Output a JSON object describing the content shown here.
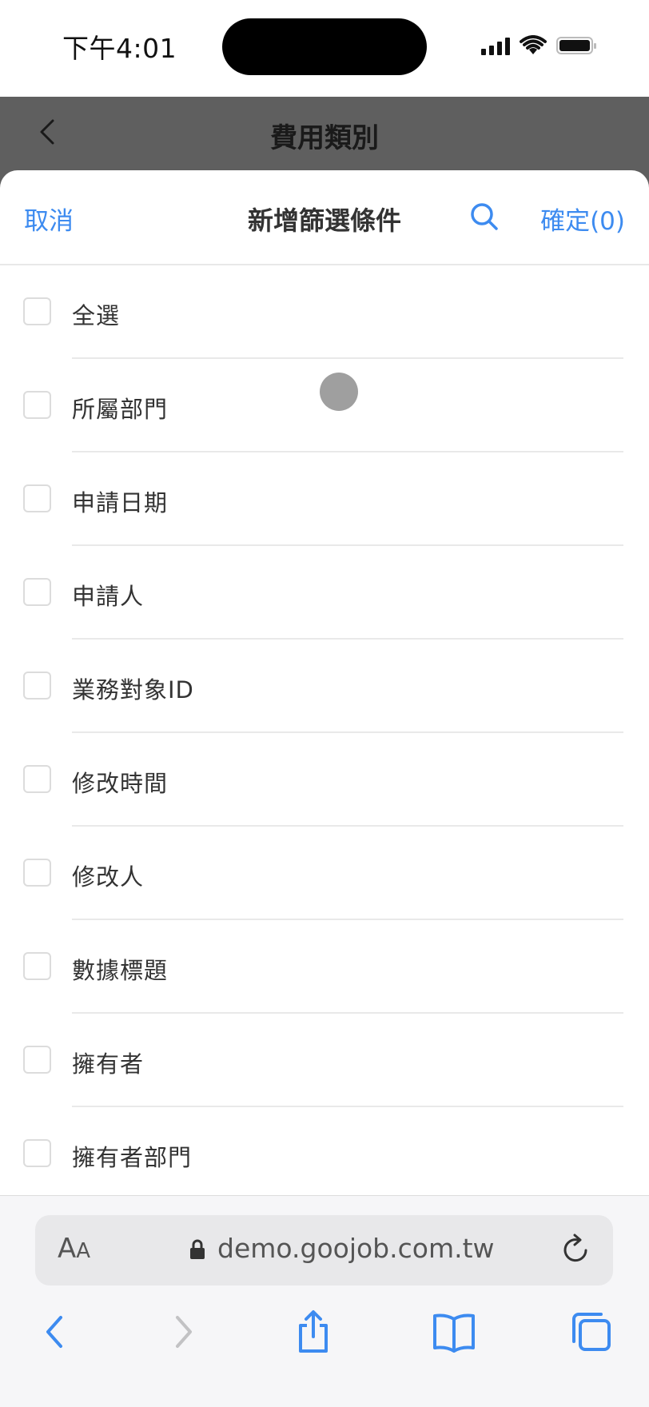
{
  "status_bar": {
    "time": "下午4:01"
  },
  "page_header": {
    "title": "費用類別"
  },
  "sheet": {
    "cancel_label": "取消",
    "title": "新增篩選條件",
    "confirm_label": "確定(0)",
    "options": [
      {
        "label": "全選",
        "checked": false
      },
      {
        "label": "所屬部門",
        "checked": false
      },
      {
        "label": "申請日期",
        "checked": false
      },
      {
        "label": "申請人",
        "checked": false
      },
      {
        "label": "業務對象ID",
        "checked": false
      },
      {
        "label": "修改時間",
        "checked": false
      },
      {
        "label": "修改人",
        "checked": false
      },
      {
        "label": "數據標題",
        "checked": false
      },
      {
        "label": "擁有者",
        "checked": false
      },
      {
        "label": "擁有者部門",
        "checked": false
      }
    ]
  },
  "browser": {
    "aa_large": "A",
    "aa_small": "A",
    "url": "demo.goojob.com.tw"
  },
  "colors": {
    "accent": "#3d8bf0",
    "dim_header": "#5f5f5f"
  },
  "icons": [
    "search-icon",
    "back-icon",
    "lock-icon",
    "reload-icon",
    "forward-icon",
    "share-icon",
    "bookmarks-icon",
    "tabs-icon"
  ]
}
